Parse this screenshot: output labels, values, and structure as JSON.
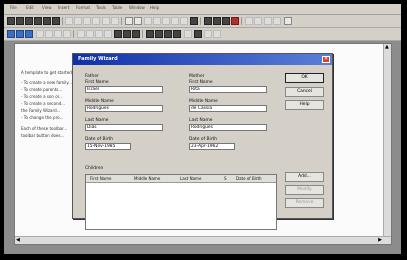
{
  "menubar": [
    "File",
    "Edit",
    "View",
    "Insert",
    "Format",
    "Tools",
    "Table",
    "Window",
    "Help"
  ],
  "document": {
    "heading": "A template to get started",
    "lines": [
      "- To create a new family...",
      "- To create parents...",
      "- To create a son or...",
      "- To create a second...",
      "the Family Wizard...",
      "- To change the pro...",
      "Each of these toolbar...",
      "toolbar button does..."
    ]
  },
  "dialog": {
    "title": "Family Wizard",
    "father": {
      "group": "Father",
      "first_name_label": "First Name",
      "first_name": "Israel",
      "middle_name_label": "Middle Name",
      "middle_name": "Rodrigues",
      "last_name_label": "Last Name",
      "last_name": "Dias",
      "dob_label": "Date of Birth",
      "dob": "15-Nov-1985"
    },
    "mother": {
      "group": "Mother",
      "first_name_label": "First Name",
      "first_name": "Rita",
      "middle_name_label": "Middle Name",
      "middle_name": "de Cassia",
      "last_name_label": "Last Name",
      "last_name": "Rodrigues",
      "dob_label": "Date of Birth",
      "dob": "23-Apr-1962"
    },
    "buttons": {
      "ok": "OK",
      "cancel": "Cancel",
      "help": "Help",
      "add": "Add...",
      "modify": "Modify",
      "remove": "Remove"
    },
    "children": {
      "group": "Children",
      "columns": [
        "First Name",
        "Middle Name",
        "Last Name",
        "S",
        "Date of Birth"
      ]
    }
  }
}
